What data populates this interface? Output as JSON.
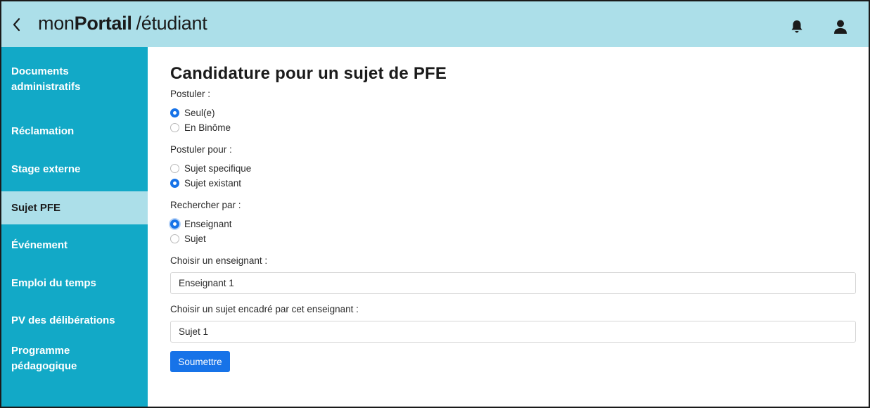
{
  "header": {
    "back_icon": "chevron-left-icon",
    "brand_part1": "mon",
    "brand_part2": "Portail",
    "brand_part3": "/étudiant",
    "bell_icon": "bell-icon",
    "user_icon": "user-icon",
    "background_color": "#acdfe9"
  },
  "sidebar": {
    "background_color": "#12a9c7",
    "active_color": "#acdfe9",
    "items": [
      {
        "line1": "Documents",
        "line2": "administratifs",
        "active": false
      },
      {
        "line1": "Réclamation",
        "line2": "",
        "active": false
      },
      {
        "line1": "Stage externe",
        "line2": "",
        "active": false
      },
      {
        "line1": "Sujet PFE",
        "line2": "",
        "active": true
      },
      {
        "line1": "Événement",
        "line2": "",
        "active": false
      },
      {
        "line1": "Emploi du temps",
        "line2": "",
        "active": false
      },
      {
        "line1": "PV des délibérations",
        "line2": "",
        "active": false
      },
      {
        "line1": "Programme",
        "line2": "pédagogique",
        "active": false
      }
    ]
  },
  "form": {
    "title": "Candidature pour un sujet de PFE",
    "postuler": {
      "label": "Postuler :",
      "options": [
        {
          "label": "Seul(e)",
          "checked": true
        },
        {
          "label": "En Binôme",
          "checked": false
        }
      ]
    },
    "postuler_pour": {
      "label": "Postuler pour :",
      "options": [
        {
          "label": "Sujet specifique",
          "checked": false
        },
        {
          "label": "Sujet existant",
          "checked": true
        }
      ]
    },
    "rechercher_par": {
      "label": "Rechercher par :",
      "options": [
        {
          "label": "Enseignant",
          "checked": true
        },
        {
          "label": "Sujet",
          "checked": false
        }
      ]
    },
    "enseignant": {
      "label": "Choisir un enseignant :",
      "value": "Enseignant 1"
    },
    "sujet": {
      "label": "Choisir un sujet encadré par cet enseignant :",
      "value": "Sujet 1"
    },
    "submit_label": "Soumettre",
    "accent_color": "#1773e8"
  }
}
